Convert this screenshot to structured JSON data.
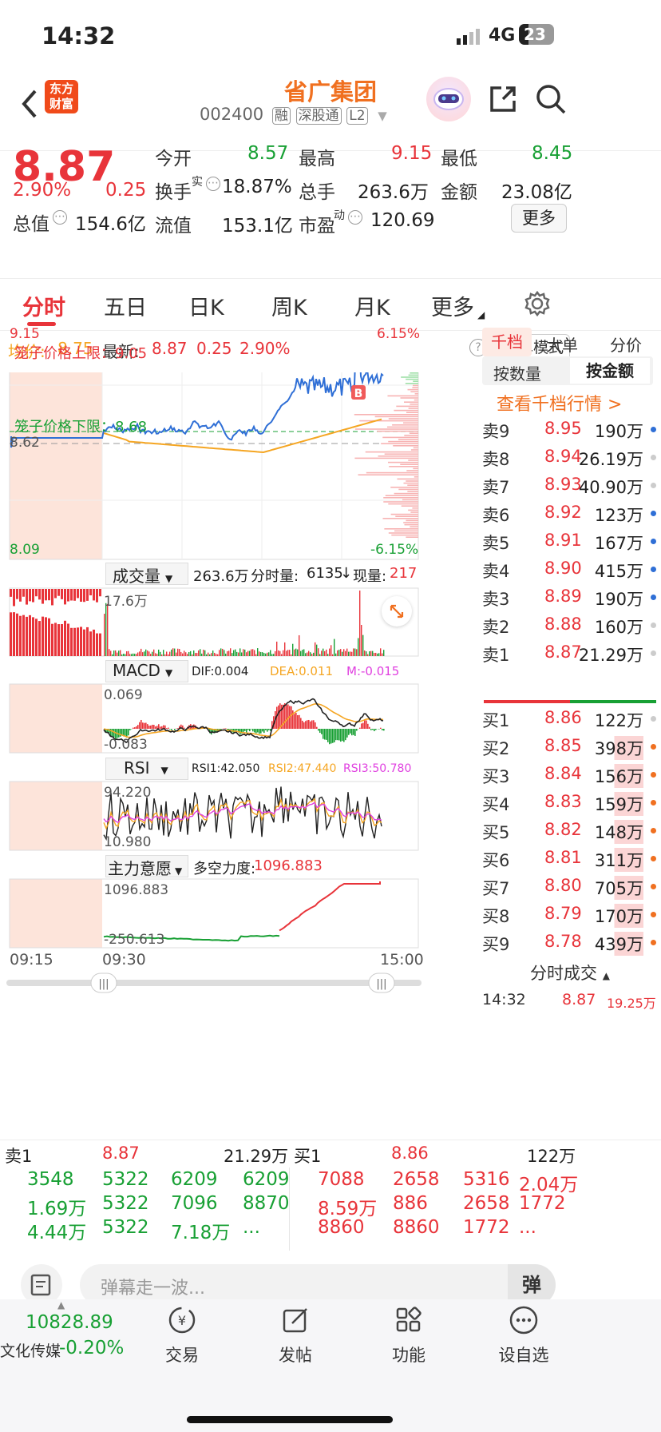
{
  "status": {
    "time": "14:32",
    "network": "4G",
    "battery": "23"
  },
  "header": {
    "title": "省广集团",
    "code": "002400",
    "tags": [
      "融",
      "深股通",
      "L2"
    ],
    "logo_line1": "东方",
    "logo_line2": "财富"
  },
  "quote": {
    "price": "8.87",
    "pct": "2.90%",
    "chg": "0.25",
    "open_label": "今开",
    "open": "8.57",
    "high_label": "最高",
    "high": "9.15",
    "low_label": "最低",
    "low": "8.45",
    "turnover_label": "换手",
    "turnover_sup": "实",
    "turnover": "18.87%",
    "vol_label": "总手",
    "vol": "263.6万",
    "amt_label": "金额",
    "amt": "23.08亿",
    "mcap_label": "总值",
    "mcap": "154.6亿",
    "float_label": "流值",
    "float": "153.1亿",
    "pe_label": "市盈",
    "pe_sup": "动",
    "pe": "120.69",
    "more": "更多"
  },
  "tabs": [
    "分时",
    "五日",
    "日K",
    "周K",
    "月K",
    "更多"
  ],
  "info": {
    "avg_label": "均价:",
    "avg": "8.75",
    "last_label": "最新:",
    "last": "8.87",
    "chg": "0.25",
    "pct": "2.90%",
    "big_order": "大单模式"
  },
  "chart": {
    "y_top": "9.15",
    "y_bottom": "8.09",
    "y_mid": "8.62",
    "pct_top": "6.15%",
    "pct_bottom": "-6.15%",
    "upper_limit": "笼子价格上限：9.05",
    "lower_limit": "笼子价格下限：8.68",
    "vol_panel": {
      "name": "成交量",
      "total": "263.6万",
      "fen_label": "分时量:",
      "fen": "6135",
      "now_label": "现量:",
      "now": "217",
      "scale": "17.6万"
    },
    "macd_panel": {
      "name": "MACD",
      "dif": "DIF:0.004",
      "dea": "DEA:0.011",
      "m": "M:-0.015",
      "top": "0.069",
      "bottom": "-0.083"
    },
    "rsi_panel": {
      "name": "RSI",
      "rsi1": "RSI1:42.050",
      "rsi2": "RSI2:47.440",
      "rsi3": "RSI3:50.780",
      "top": "94.220",
      "bottom": "10.980"
    },
    "zlyy_panel": {
      "name": "主力意愿",
      "label": "多空力度:",
      "value": "1096.883",
      "top": "1096.883",
      "bottom": "-250.613"
    },
    "times": [
      "09:15",
      "09:30",
      "15:00"
    ]
  },
  "book": {
    "tabs1": [
      "千档",
      "大单",
      "分价"
    ],
    "tabs2": [
      "按数量",
      "按金额"
    ],
    "link": "查看千档行情 >",
    "asks": [
      {
        "label": "卖9",
        "price": "8.95",
        "vol": "190万",
        "dot": "#2f6fd6"
      },
      {
        "label": "卖8",
        "price": "8.94",
        "vol": "26.19万",
        "dot": "#ccc"
      },
      {
        "label": "卖7",
        "price": "8.93",
        "vol": "40.90万",
        "dot": "#ccc"
      },
      {
        "label": "卖6",
        "price": "8.92",
        "vol": "123万",
        "dot": "#2f6fd6"
      },
      {
        "label": "卖5",
        "price": "8.91",
        "vol": "167万",
        "dot": "#2f6fd6"
      },
      {
        "label": "卖4",
        "price": "8.90",
        "vol": "415万",
        "dot": "#2f6fd6"
      },
      {
        "label": "卖3",
        "price": "8.89",
        "vol": "190万",
        "dot": "#2f6fd6"
      },
      {
        "label": "卖2",
        "price": "8.88",
        "vol": "160万",
        "dot": "#ccc"
      },
      {
        "label": "卖1",
        "price": "8.87",
        "vol": "21.29万",
        "dot": "#ccc"
      }
    ],
    "bids": [
      {
        "label": "买1",
        "price": "8.86",
        "vol": "122万",
        "dot": "#ccc"
      },
      {
        "label": "买2",
        "price": "8.85",
        "vol": "398万",
        "dot": "#f07020"
      },
      {
        "label": "买3",
        "price": "8.84",
        "vol": "156万",
        "dot": "#f07020"
      },
      {
        "label": "买4",
        "price": "8.83",
        "vol": "159万",
        "dot": "#f07020"
      },
      {
        "label": "买5",
        "price": "8.82",
        "vol": "148万",
        "dot": "#f07020"
      },
      {
        "label": "买6",
        "price": "8.81",
        "vol": "311万",
        "dot": "#f07020"
      },
      {
        "label": "买7",
        "price": "8.80",
        "vol": "705万",
        "dot": "#f07020"
      },
      {
        "label": "买8",
        "price": "8.79",
        "vol": "170万",
        "dot": "#f07020"
      },
      {
        "label": "买9",
        "price": "8.78",
        "vol": "439万",
        "dot": "#f07020"
      }
    ],
    "trade_title": "分时成交",
    "trade": {
      "time": "14:32",
      "price": "8.87",
      "vol": "19.25万"
    }
  },
  "bottom_table": {
    "sell_label": "卖1",
    "sell_price": "8.87",
    "sell_vol": "21.29万",
    "buy_label": "买1",
    "buy_price": "8.86",
    "buy_vol": "122万",
    "sell_rows": [
      [
        "3548",
        "5322",
        "6209",
        "6209"
      ],
      [
        "1.69万",
        "5322",
        "7096",
        "8870"
      ],
      [
        "4.44万",
        "5322",
        "7.18万",
        "..."
      ]
    ],
    "buy_rows": [
      [
        "7088",
        "2658",
        "5316",
        "2.04万"
      ],
      [
        "8.59万",
        "886",
        "2658",
        "1772"
      ],
      [
        "8860",
        "8860",
        "1772",
        "..."
      ]
    ]
  },
  "danmu": {
    "placeholder": "弹幕走一波...",
    "btn": "弹"
  },
  "bottombar": {
    "index_value": "10828.89",
    "index_name": "文化传媒",
    "index_pct": "-0.20%",
    "items": [
      "交易",
      "发帖",
      "功能",
      "设自选"
    ]
  }
}
